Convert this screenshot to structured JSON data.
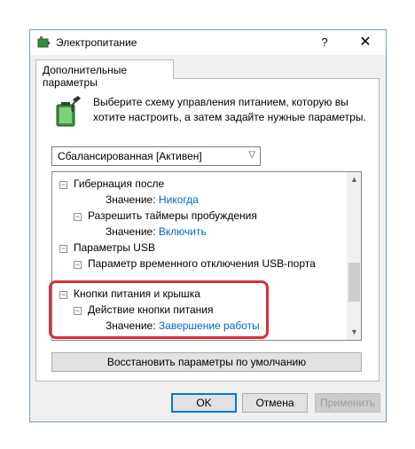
{
  "window": {
    "title": "Электропитание",
    "help_glyph": "?",
    "close_glyph": "✕"
  },
  "tab": {
    "label": "Дополнительные параметры"
  },
  "description": "Выберите схему управления питанием, которую вы хотите настроить, а затем задайте нужные параметры.",
  "scheme_select": {
    "selected": "Сбалансированная [Активен]"
  },
  "tree": {
    "items": [
      {
        "expander": "⊟",
        "label": "Гибернация после"
      },
      {
        "value_label": "Значение:",
        "value": "Никогда"
      },
      {
        "expander": "⊟",
        "label": "Разрешить таймеры пробуждения"
      },
      {
        "value_label": "Значение:",
        "value": "Включить"
      },
      {
        "expander": "⊟",
        "label": "Параметры USB"
      },
      {
        "expander": "⊟",
        "label": "Параметр временного отключения USB-порта"
      },
      {
        "expander": "⊟",
        "label": "Кнопки питания и крышка"
      },
      {
        "expander": "⊟",
        "label": "Действие кнопки питания"
      },
      {
        "value_label": "Значение:",
        "value": "Завершение работы"
      }
    ]
  },
  "buttons": {
    "restore": "Восстановить параметры по умолчанию",
    "ok": "OK",
    "cancel": "Отмена",
    "apply": "Применить"
  },
  "colors": {
    "highlight": "#d6313b",
    "link_value": "#0066cc",
    "accent": "#0078d7"
  }
}
